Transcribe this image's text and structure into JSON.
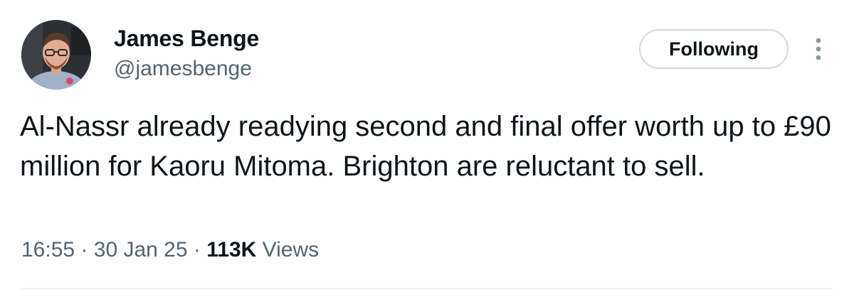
{
  "tweet": {
    "author": {
      "display_name": "James Benge",
      "handle": "@jamesbenge",
      "avatar_icon": "profile-photo"
    },
    "follow_button_label": "Following",
    "more_icon": "vertical-ellipsis-icon",
    "text": "Al-Nassr already readying second and final offer worth up to £90 million for Kaoru Mitoma. Brighton are reluctant to sell.",
    "time": "16:55",
    "date": "30 Jan 25",
    "separator": "·",
    "views_count": "113K",
    "views_label": "Views"
  },
  "colors": {
    "text_primary": "#0f1419",
    "text_secondary": "#536471",
    "border": "#cfd9de",
    "divider": "#eff3f4"
  }
}
